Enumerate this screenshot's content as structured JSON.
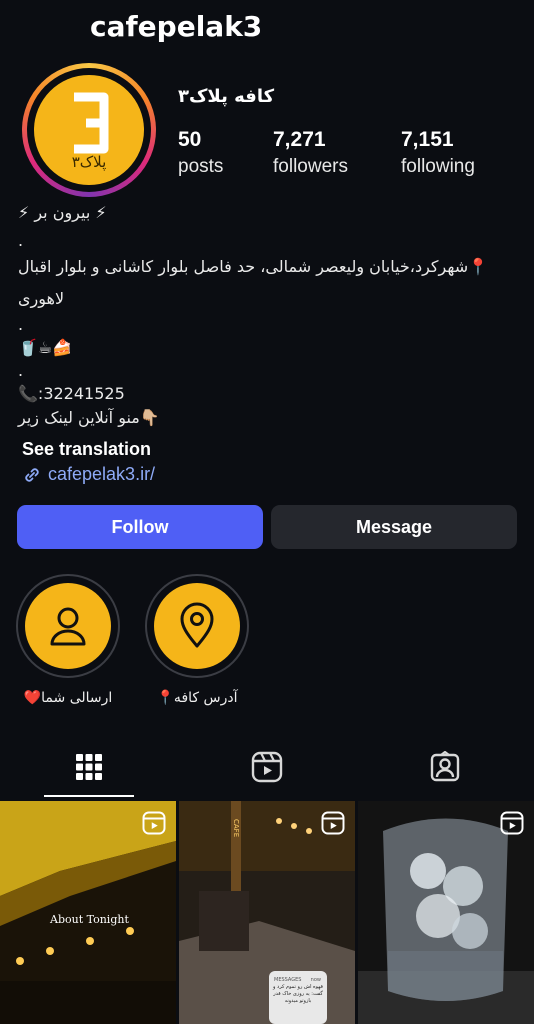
{
  "profile": {
    "username": "cafepelak3",
    "display_name": "کافه پلاک۳",
    "avatar_logo_text": "پلاک۳"
  },
  "stats": {
    "posts": {
      "value": "50",
      "label": "posts"
    },
    "followers": {
      "value": "7,271",
      "label": "followers"
    },
    "following": {
      "value": "7,151",
      "label": "following"
    }
  },
  "bio": {
    "line1": "⚡ بیرون بر ⚡",
    "dot1": ".",
    "address_line1": "📍شهرکرد،خیابان ولیعصر شمالی، حد فاصل بلوار کاشانی و بلوار اقبال",
    "address_line2": "لاهوری",
    "dot2": ".",
    "emojis": "🥤☕🍰",
    "dot3": ".",
    "phone": "📞:32241525",
    "menu_line": "👇🏼منو آنلاین لینک زیر",
    "see_translation": "See translation",
    "link": "cafepelak3.ir/"
  },
  "buttons": {
    "follow": "Follow",
    "message": "Message"
  },
  "highlights": [
    {
      "label": "ارسالی شما❤️",
      "icon": "user-icon"
    },
    {
      "label": "آدرس کافه📍",
      "icon": "location-pin-icon"
    }
  ],
  "tabs": [
    {
      "name": "posts-grid",
      "icon": "grid-icon"
    },
    {
      "name": "reels",
      "icon": "reels-icon"
    },
    {
      "name": "tagged",
      "icon": "tagged-user-icon"
    }
  ],
  "grid_posts": [
    {
      "overlay_text": "About Tonight",
      "type": "reel"
    },
    {
      "overlay_text": "CAFE",
      "message_header": "MESSAGES",
      "message_time": "now",
      "message_body": "قهوه اش رو تموم کرد و گفت: یه روزی خاک قدر بازوتو میدونه",
      "type": "reel"
    },
    {
      "overlay_text": "",
      "type": "reel"
    }
  ],
  "colors": {
    "background": "#0b0d12",
    "follow_button": "#4f5ff5",
    "message_button": "#25272d",
    "brand_yellow": "#f5b519",
    "link": "#8eaaf7"
  }
}
